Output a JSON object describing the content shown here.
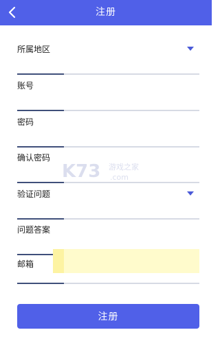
{
  "header": {
    "title": "注册",
    "back_icon": "chevron-left-icon"
  },
  "form": {
    "region": {
      "label": "所属地区",
      "icon": "dropdown-arrow-icon"
    },
    "account": {
      "label": "账号",
      "value": ""
    },
    "password": {
      "label": "密码",
      "value": ""
    },
    "confirm_password": {
      "label": "确认密码",
      "value": ""
    },
    "security_question": {
      "label": "验证问题",
      "icon": "dropdown-arrow-icon"
    },
    "security_answer": {
      "label": "问题答案",
      "value": ""
    },
    "email": {
      "label": "邮箱",
      "value": ""
    }
  },
  "submit": {
    "label": "注册"
  },
  "watermark": {
    "text": "k73 游戏之家 .com"
  },
  "colors": {
    "primary": "#5060e8",
    "underline": "#d6dae4",
    "underline_accent": "#3f4f7a",
    "email_highlight": "#fffbcc"
  }
}
